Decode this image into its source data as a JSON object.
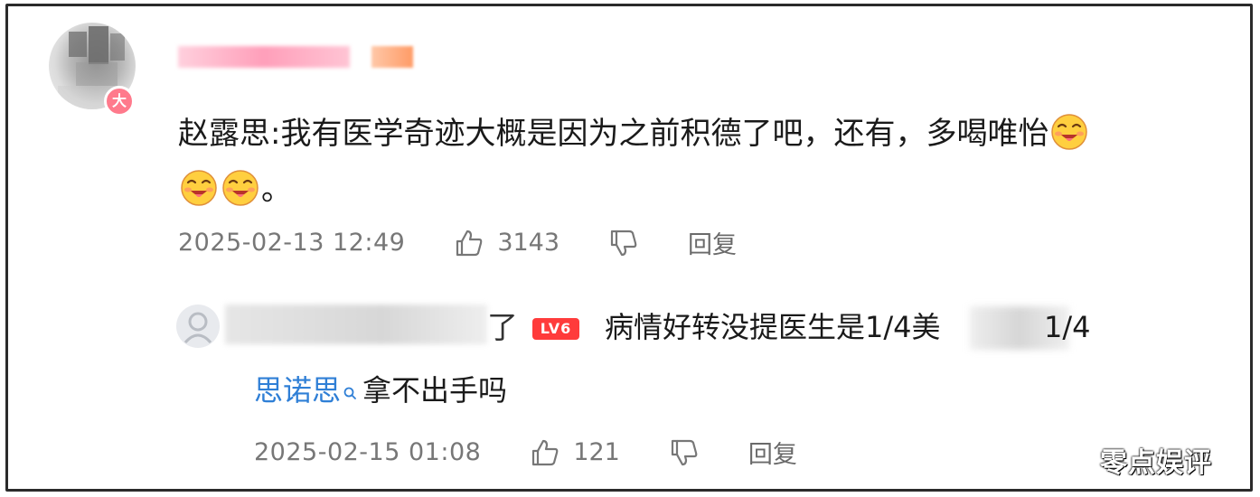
{
  "comment": {
    "author_badge": "大",
    "text_part1": "赵露思:我有医学奇迹大概是因为之前积德了吧，还有，多喝唯怡",
    "text_part2": "。",
    "timestamp": "2025-02-13 12:49",
    "likes": "3143",
    "reply_label": "回复"
  },
  "reply": {
    "name_tail": "了",
    "level_badge": "LV6",
    "text_head": "病情好转没提医生是1/4美",
    "text_tail": "1/4",
    "mention": "思诺思",
    "text_after_mention": "拿不出手吗",
    "timestamp": "2025-02-15 01:08",
    "likes": "121",
    "reply_label": "回复"
  },
  "watermark": "零点娱评",
  "colors": {
    "mention": "#2f7fd6",
    "level_badge": "#ff3b3b",
    "avatar_badge": "#ff7a8c",
    "meta_text": "#777777"
  },
  "icons": {
    "like": "thumbs-up-icon",
    "dislike": "thumbs-down-icon",
    "emoji": "drool-face-emoji",
    "mention": "search-icon"
  }
}
